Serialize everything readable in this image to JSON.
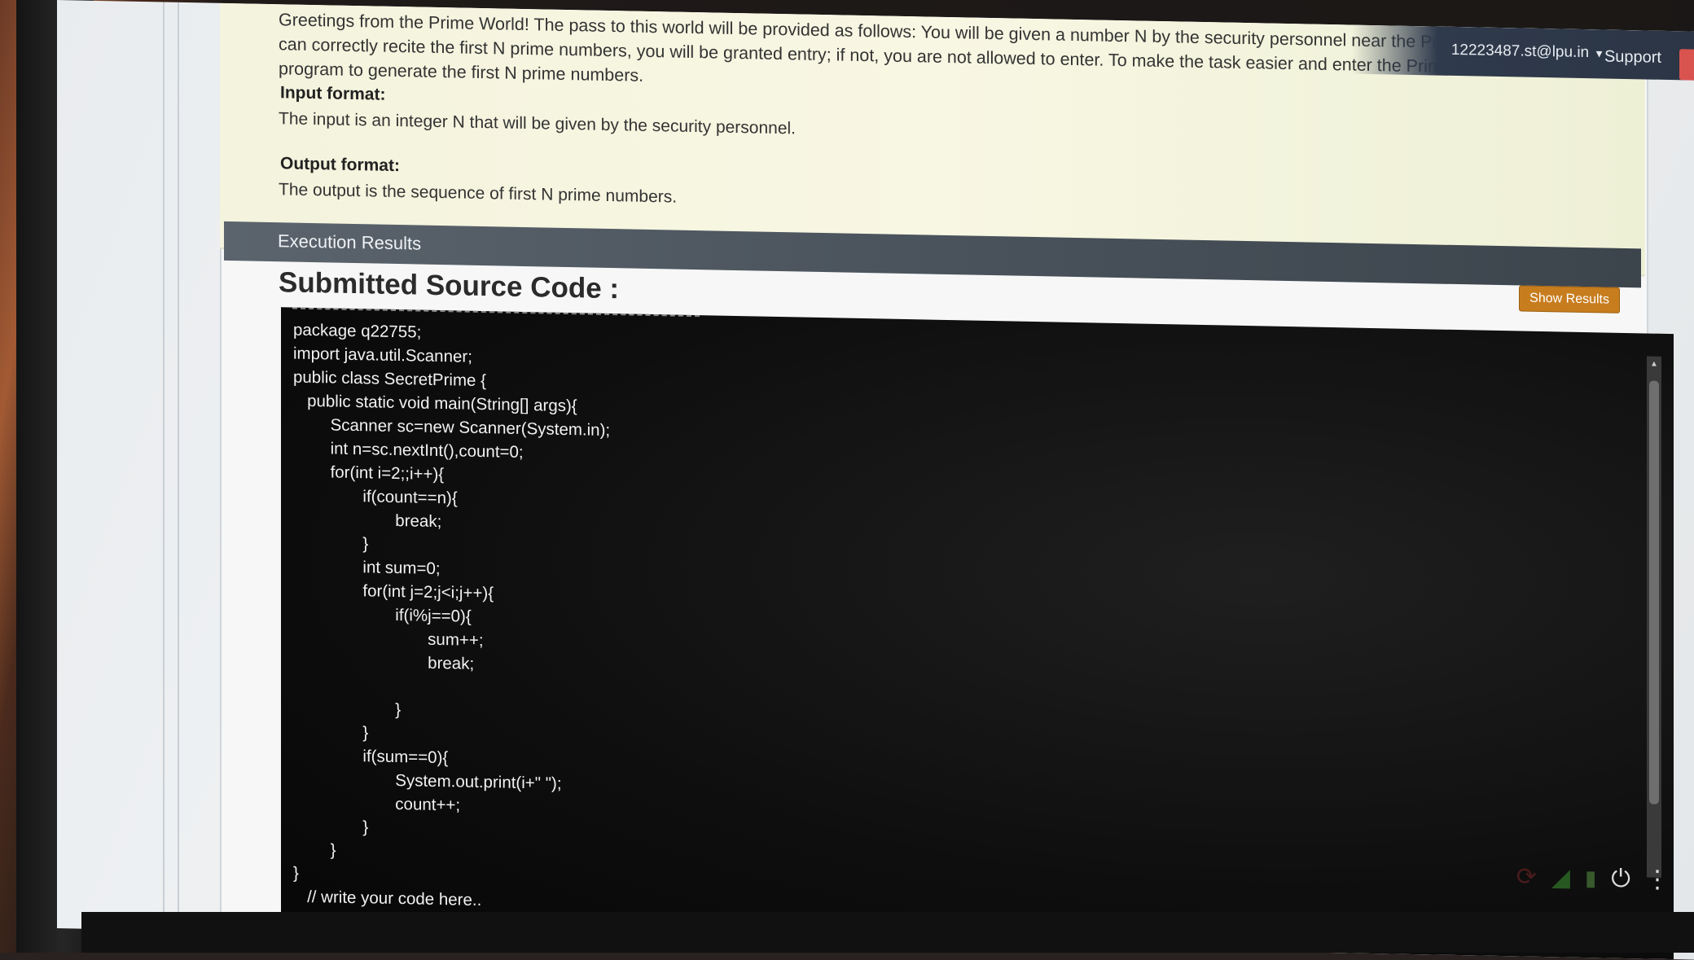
{
  "header": {
    "user_email": "12223487.st@lpu.in",
    "support_label": "Support"
  },
  "problem": {
    "intro": "Greetings from the Prime World! The pass to this world will be provided as follows: You will be given a number N by the security personnel near the Prime World gate. If you can correctly recite the first N prime numbers, you will be granted entry; if not, you are not allowed to enter. To make the task easier and enter the Prime world, write a Java program to generate the first N prime numbers.",
    "input_heading": "Input format:",
    "input_text": "The input is an integer N that will be given by the security personnel.",
    "output_heading": "Output format:",
    "output_text": "The output is the sequence of first N prime numbers."
  },
  "results": {
    "bar_label": "Execution Results",
    "show_results_label": "Show Results"
  },
  "source": {
    "title": "Submitted Source Code :",
    "lines": [
      "package q22755;",
      "import java.util.Scanner;",
      "public class SecretPrime {",
      "   public static void main(String[] args){",
      "        Scanner sc=new Scanner(System.in);",
      "        int n=sc.nextInt(),count=0;",
      "        for(int i=2;;i++){",
      "               if(count==n){",
      "                      break;",
      "               }",
      "               int sum=0;",
      "               for(int j=2;j<i;j++){",
      "                      if(i%j==0){",
      "                             sum++;",
      "                             break;",
      "",
      "                      }",
      "               }",
      "               if(sum==0){",
      "                      System.out.print(i+\" \");",
      "                      count++;",
      "               }",
      "        }",
      "}",
      "   // write your code here.."
    ]
  },
  "icons": {
    "tray": [
      "refresh-icon",
      "wifi-icon",
      "battery-icon",
      "power-icon",
      "more-vertical-icon"
    ]
  },
  "colors": {
    "accent_button": "#c77d1e",
    "results_bar": "#4a535c",
    "problem_bg": "#f6f5e0",
    "code_bg": "#0e0e0e"
  }
}
